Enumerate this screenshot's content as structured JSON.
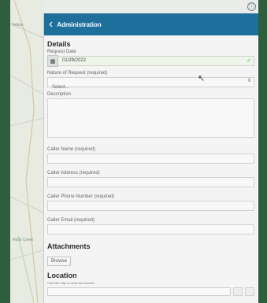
{
  "map": {
    "labels": [
      "Yellow",
      "Rock Creek"
    ]
  },
  "topbar": {
    "info_icon": "ⓘ"
  },
  "header": {
    "back_icon": "‹",
    "title": "Administration"
  },
  "details": {
    "title": "Details",
    "request_date_label": "Request Date",
    "request_date_value": "01/29/2022",
    "nature_label": "Nature of Request (required)",
    "nature_value": "Select...",
    "description_label": "Description",
    "caller_name_label": "Caller Name (required)",
    "caller_address_label": "Caller Address (required)",
    "caller_phone_label": "Caller Phone Number (required)",
    "caller_email_label": "Caller Email (required)"
  },
  "attachments": {
    "title": "Attachments",
    "browse_label": "Browse"
  },
  "location": {
    "title": "Location",
    "hint": "Click the map to draw the location"
  },
  "colors": {
    "header": "#1f6f9c",
    "valid": "#3f9a3f"
  }
}
